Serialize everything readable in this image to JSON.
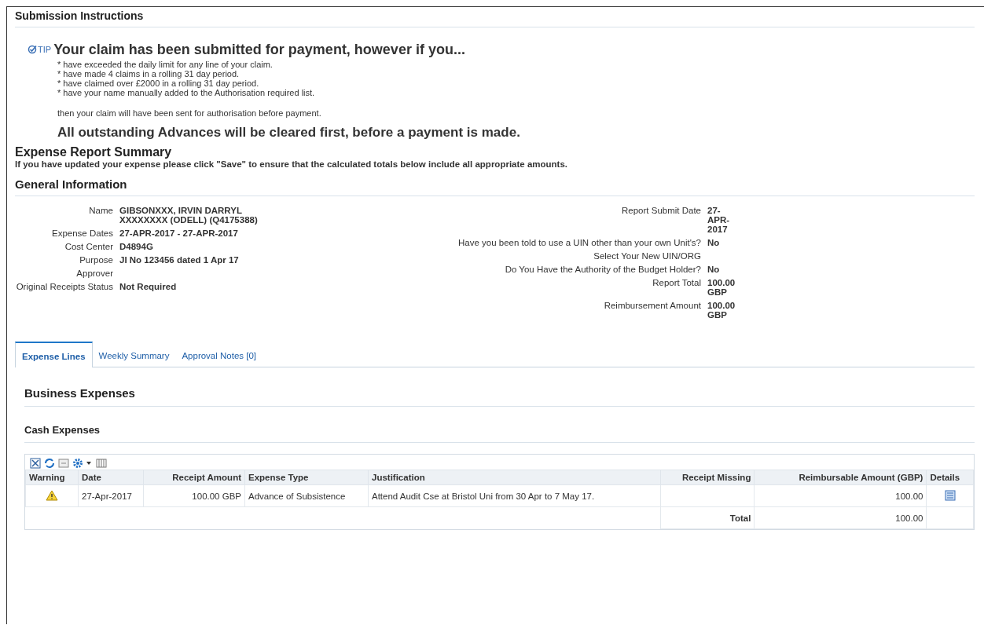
{
  "submission": {
    "title": "Submission Instructions",
    "tip_label": "TIP",
    "tip_heading": "Your claim has been submitted for payment, however if you...",
    "bullets": [
      "* have exceeded the daily limit for any line of your claim.",
      "* have made 4 claims in a rolling 31 day period.",
      "* have claimed over £2000 in a rolling 31 day period.",
      "* have your name manually added to the Authorisation required list."
    ],
    "then_text": "then your claim will have been sent for authorisation before payment.",
    "advances_note": "All outstanding Advances will be cleared first, before a payment is made."
  },
  "summary": {
    "title": "Expense Report Summary",
    "note": "If you have updated your expense please click \"Save\" to ensure that the calculated totals below include all appropriate amounts."
  },
  "general": {
    "title": "General Information",
    "left": [
      {
        "label": "Name",
        "value": "GIBSONXXX, IRVIN DARRYL XXXXXXXX (ODELL) (Q4175388)"
      },
      {
        "label": "Expense Dates",
        "value": "27-APR-2017 - 27-APR-2017"
      },
      {
        "label": "Cost Center",
        "value": "D4894G"
      },
      {
        "label": "Purpose",
        "value": "JI No 123456 dated 1 Apr 17"
      },
      {
        "label": "Approver"
      },
      {
        "label": "Original Receipts Status",
        "value": "Not Required"
      }
    ],
    "right": [
      {
        "label": "Report Submit Date",
        "value": "27-APR-2017"
      },
      {
        "label": "Have you been told to use a UIN other than your own Unit's?",
        "value": "No"
      },
      {
        "label": "Select Your New UIN/ORG"
      },
      {
        "label": "Do You Have the Authority of the Budget Holder?",
        "value": "No"
      },
      {
        "label": "Report Total",
        "value": "100.00 GBP"
      },
      {
        "label": "Reimbursement Amount",
        "value": "100.00 GBP"
      }
    ]
  },
  "tabs": [
    {
      "label": "Expense Lines",
      "selected": true
    },
    {
      "label": "Weekly Summary",
      "selected": false
    },
    {
      "label": "Approval Notes [0]",
      "selected": false
    }
  ],
  "business_title": "Business Expenses",
  "cash": {
    "title": "Cash Expenses",
    "columns": [
      "Warning",
      "Date",
      "Receipt Amount",
      "Expense Type",
      "Justification",
      "Receipt Missing",
      "Reimbursable Amount (GBP)",
      "Details"
    ],
    "rows": [
      {
        "warning": true,
        "date": "27-Apr-2017",
        "receipt_amount": "100.00 GBP",
        "expense_type": "Advance of Subsistence",
        "justification": "Attend Audit Cse at Bristol Uni from 30 Apr to 7 May 17.",
        "reimbursable": "100.00"
      }
    ],
    "total_label": "Total",
    "total_value": "100.00"
  }
}
